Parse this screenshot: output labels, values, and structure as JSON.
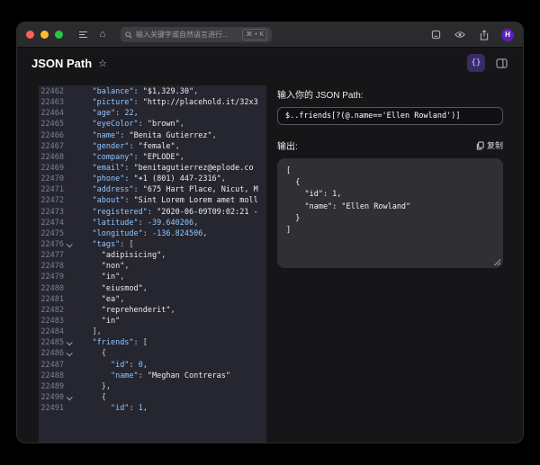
{
  "browser": {
    "search_placeholder": "输入关键字或自然语言进行...",
    "search_shortcut": "⌘ + K",
    "avatar_initial": "H",
    "home_glyph": "⌂"
  },
  "header": {
    "title": "JSON Path",
    "star_icon": "☆",
    "app_button_glyph": "{}"
  },
  "editor": {
    "lines": [
      {
        "n": "22462",
        "c": [
          [
            "p",
            "    "
          ],
          [
            "k",
            "\"balance\""
          ],
          [
            "p",
            ": "
          ],
          [
            "s",
            "\"$1,329.30\""
          ],
          [
            "p",
            ","
          ]
        ]
      },
      {
        "n": "22463",
        "c": [
          [
            "p",
            "    "
          ],
          [
            "k",
            "\"picture\""
          ],
          [
            "p",
            ": "
          ],
          [
            "s",
            "\"http://placehold.it/32x3"
          ]
        ]
      },
      {
        "n": "22464",
        "c": [
          [
            "p",
            "    "
          ],
          [
            "k",
            "\"age\""
          ],
          [
            "p",
            ": "
          ],
          [
            "d",
            "22"
          ],
          [
            "p",
            ","
          ]
        ]
      },
      {
        "n": "22465",
        "c": [
          [
            "p",
            "    "
          ],
          [
            "k",
            "\"eyeColor\""
          ],
          [
            "p",
            ": "
          ],
          [
            "s",
            "\"brown\""
          ],
          [
            "p",
            ","
          ]
        ]
      },
      {
        "n": "22466",
        "c": [
          [
            "p",
            "    "
          ],
          [
            "k",
            "\"name\""
          ],
          [
            "p",
            ": "
          ],
          [
            "s",
            "\"Benita Gutierrez\""
          ],
          [
            "p",
            ","
          ]
        ]
      },
      {
        "n": "22467",
        "c": [
          [
            "p",
            "    "
          ],
          [
            "k",
            "\"gender\""
          ],
          [
            "p",
            ": "
          ],
          [
            "s",
            "\"female\""
          ],
          [
            "p",
            ","
          ]
        ]
      },
      {
        "n": "22468",
        "c": [
          [
            "p",
            "    "
          ],
          [
            "k",
            "\"company\""
          ],
          [
            "p",
            ": "
          ],
          [
            "s",
            "\"EPLODE\""
          ],
          [
            "p",
            ","
          ]
        ]
      },
      {
        "n": "22469",
        "c": [
          [
            "p",
            "    "
          ],
          [
            "k",
            "\"email\""
          ],
          [
            "p",
            ": "
          ],
          [
            "s",
            "\"benitagutierrez@eplode.co"
          ]
        ]
      },
      {
        "n": "22470",
        "c": [
          [
            "p",
            "    "
          ],
          [
            "k",
            "\"phone\""
          ],
          [
            "p",
            ": "
          ],
          [
            "s",
            "\"+1 (801) 447-2316\""
          ],
          [
            "p",
            ","
          ]
        ]
      },
      {
        "n": "22471",
        "c": [
          [
            "p",
            "    "
          ],
          [
            "k",
            "\"address\""
          ],
          [
            "p",
            ": "
          ],
          [
            "s",
            "\"675 Hart Place, Nicut, M"
          ]
        ]
      },
      {
        "n": "22472",
        "c": [
          [
            "p",
            "    "
          ],
          [
            "k",
            "\"about\""
          ],
          [
            "p",
            ": "
          ],
          [
            "s",
            "\"Sint Lorem Lorem amet moll"
          ]
        ]
      },
      {
        "n": "22473",
        "c": [
          [
            "p",
            "    "
          ],
          [
            "k",
            "\"registered\""
          ],
          [
            "p",
            ": "
          ],
          [
            "s",
            "\"2020-06-09T09:02:21 -"
          ]
        ]
      },
      {
        "n": "22474",
        "c": [
          [
            "p",
            "    "
          ],
          [
            "k",
            "\"latitude\""
          ],
          [
            "p",
            ": "
          ],
          [
            "d",
            "-39.640206"
          ],
          [
            "p",
            ","
          ]
        ]
      },
      {
        "n": "22475",
        "c": [
          [
            "p",
            "    "
          ],
          [
            "k",
            "\"longitude\""
          ],
          [
            "p",
            ": "
          ],
          [
            "d",
            "-136.824506"
          ],
          [
            "p",
            ","
          ]
        ]
      },
      {
        "n": "22476",
        "caret": true,
        "c": [
          [
            "p",
            "    "
          ],
          [
            "k",
            "\"tags\""
          ],
          [
            "p",
            ": ["
          ]
        ]
      },
      {
        "n": "22477",
        "c": [
          [
            "p",
            "      "
          ],
          [
            "s",
            "\"adipisicing\""
          ],
          [
            "p",
            ","
          ]
        ]
      },
      {
        "n": "22478",
        "c": [
          [
            "p",
            "      "
          ],
          [
            "s",
            "\"non\""
          ],
          [
            "p",
            ","
          ]
        ]
      },
      {
        "n": "22479",
        "c": [
          [
            "p",
            "      "
          ],
          [
            "s",
            "\"in\""
          ],
          [
            "p",
            ","
          ]
        ]
      },
      {
        "n": "22480",
        "c": [
          [
            "p",
            "      "
          ],
          [
            "s",
            "\"eiusmod\""
          ],
          [
            "p",
            ","
          ]
        ]
      },
      {
        "n": "22481",
        "c": [
          [
            "p",
            "      "
          ],
          [
            "s",
            "\"ea\""
          ],
          [
            "p",
            ","
          ]
        ]
      },
      {
        "n": "22482",
        "c": [
          [
            "p",
            "      "
          ],
          [
            "s",
            "\"reprehenderit\""
          ],
          [
            "p",
            ","
          ]
        ]
      },
      {
        "n": "22483",
        "c": [
          [
            "p",
            "      "
          ],
          [
            "s",
            "\"in\""
          ]
        ]
      },
      {
        "n": "22484",
        "c": [
          [
            "p",
            "    ],"
          ]
        ]
      },
      {
        "n": "22485",
        "caret": true,
        "c": [
          [
            "p",
            "    "
          ],
          [
            "k",
            "\"friends\""
          ],
          [
            "p",
            ": ["
          ]
        ]
      },
      {
        "n": "22486",
        "caret": true,
        "c": [
          [
            "p",
            "      {"
          ]
        ]
      },
      {
        "n": "22487",
        "c": [
          [
            "p",
            "        "
          ],
          [
            "k",
            "\"id\""
          ],
          [
            "p",
            ": "
          ],
          [
            "d",
            "0"
          ],
          [
            "p",
            ","
          ]
        ]
      },
      {
        "n": "22488",
        "c": [
          [
            "p",
            "        "
          ],
          [
            "k",
            "\"name\""
          ],
          [
            "p",
            ": "
          ],
          [
            "s",
            "\"Meghan Contreras\""
          ]
        ]
      },
      {
        "n": "22489",
        "c": [
          [
            "p",
            "      },"
          ]
        ]
      },
      {
        "n": "22490",
        "caret": true,
        "c": [
          [
            "p",
            "      {"
          ]
        ]
      },
      {
        "n": "22491",
        "c": [
          [
            "p",
            "        "
          ],
          [
            "k",
            "\"id\""
          ],
          [
            "p",
            ": "
          ],
          [
            "d",
            "1"
          ],
          [
            "p",
            ","
          ]
        ]
      }
    ]
  },
  "panel": {
    "input_label": "输入你的 JSON Path:",
    "input_value": "$..friends[?(@.name=='Ellen Rowland')]",
    "output_label": "输出:",
    "copy_label": "复制",
    "output_value": "[\n  {\n    \"id\": 1,\n    \"name\": \"Ellen Rowland\"\n  }\n]"
  },
  "colors": {
    "traffic_red": "#ff5f57",
    "traffic_yellow": "#febc2e",
    "traffic_green": "#28c840",
    "accent_purple": "#5b21b6",
    "editor_bg": "#262630",
    "key_color": "#8fc7ff",
    "string_color": "#ececec"
  }
}
